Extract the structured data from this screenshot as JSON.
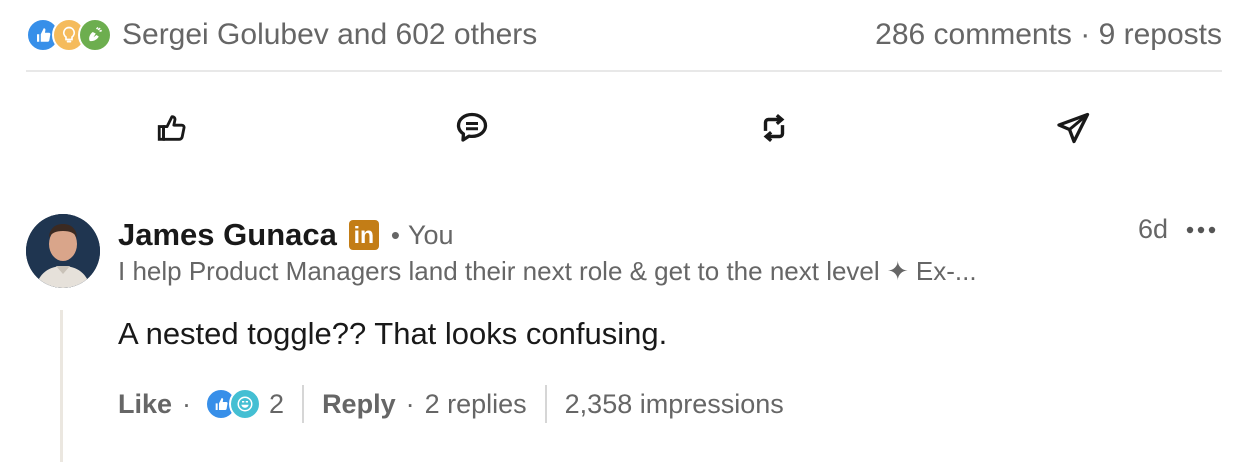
{
  "social": {
    "reactions": [
      "like-icon",
      "insightful-icon",
      "celebrate-icon"
    ],
    "reactors_text": "Sergei Golubev and 602 others",
    "comments_count": "286 comments",
    "separator": "·",
    "reposts_count": "9 reposts"
  },
  "actions": [
    {
      "name": "like",
      "icon": "thumbs-up-icon"
    },
    {
      "name": "comment",
      "icon": "comment-icon"
    },
    {
      "name": "repost",
      "icon": "repost-icon"
    },
    {
      "name": "send",
      "icon": "send-icon"
    }
  ],
  "comment": {
    "author": "James Gunaca",
    "badge": "in",
    "you_label": "You",
    "bullet": "•",
    "headline": "I help Product Managers land their next role & get to the next level ✦ Ex-...",
    "time": "6d",
    "text": "A nested toggle?? That looks confusing.",
    "like_label": "Like",
    "reaction_count": "2",
    "reply_label": "Reply",
    "replies": "2 replies",
    "impressions": "2,358 impressions",
    "dot": "·"
  },
  "colors": {
    "muted": "#666666",
    "like_blue": "#378fe9",
    "insight_yellow": "#f5bb5c",
    "celebrate_green": "#6dae4f",
    "linkedin_badge": "#c37d16"
  }
}
